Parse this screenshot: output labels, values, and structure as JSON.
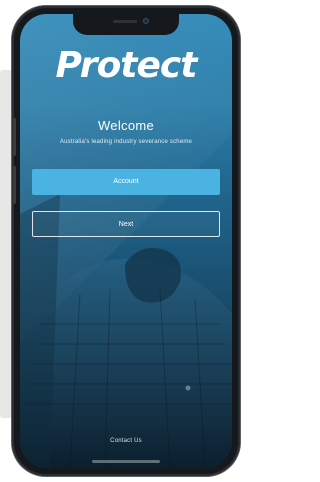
{
  "app": {
    "logo_text": "Protect",
    "welcome": "Welcome",
    "tagline": "Australia's leading industry severance scheme"
  },
  "actions": {
    "account_label": "Account",
    "next_label": "Next",
    "contact_label": "Contact Us"
  },
  "colors": {
    "accent": "#4ab3e2",
    "screen_top": "#2b86b6",
    "screen_bottom": "#0f2638",
    "text": "#ffffff"
  },
  "icons": [
    "phone-device",
    "speaker-icon",
    "camera-icon"
  ]
}
